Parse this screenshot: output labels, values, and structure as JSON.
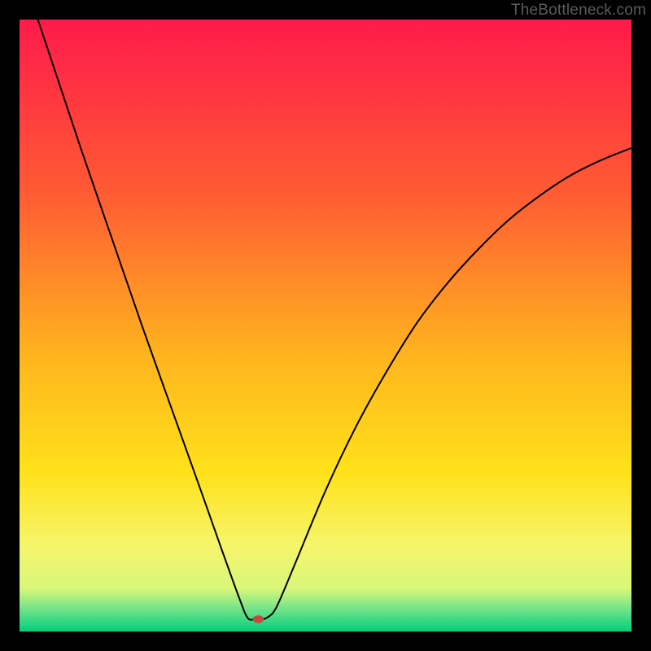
{
  "attribution": "TheBottleneck.com",
  "chart_data": {
    "type": "line",
    "title": "",
    "xlabel": "",
    "ylabel": "",
    "xlim": [
      0,
      100
    ],
    "ylim": [
      0,
      100
    ],
    "background_gradient": {
      "stops": [
        {
          "offset": 0.0,
          "color": "#ff1a4b"
        },
        {
          "offset": 0.28,
          "color": "#ff5a34"
        },
        {
          "offset": 0.55,
          "color": "#ffb41e"
        },
        {
          "offset": 0.74,
          "color": "#ffe11a"
        },
        {
          "offset": 0.86,
          "color": "#f6f56b"
        },
        {
          "offset": 0.93,
          "color": "#d8f77a"
        },
        {
          "offset": 0.965,
          "color": "#6ee28a"
        },
        {
          "offset": 1.0,
          "color": "#00d07a"
        }
      ]
    },
    "series": [
      {
        "name": "bottleneck-curve",
        "color": "#000000",
        "points": [
          {
            "x": 3.0,
            "y": 100.0
          },
          {
            "x": 6.0,
            "y": 91.0
          },
          {
            "x": 10.0,
            "y": 79.0
          },
          {
            "x": 15.0,
            "y": 64.5
          },
          {
            "x": 20.0,
            "y": 50.0
          },
          {
            "x": 25.0,
            "y": 36.0
          },
          {
            "x": 30.0,
            "y": 22.0
          },
          {
            "x": 33.0,
            "y": 13.5
          },
          {
            "x": 36.0,
            "y": 5.2
          },
          {
            "x": 37.3,
            "y": 2.2
          },
          {
            "x": 38.5,
            "y": 2.0
          },
          {
            "x": 39.5,
            "y": 2.0
          },
          {
            "x": 40.5,
            "y": 2.3
          },
          {
            "x": 42.0,
            "y": 4.0
          },
          {
            "x": 45.0,
            "y": 11.0
          },
          {
            "x": 50.0,
            "y": 23.0
          },
          {
            "x": 55.0,
            "y": 33.5
          },
          {
            "x": 60.0,
            "y": 42.5
          },
          {
            "x": 65.0,
            "y": 50.5
          },
          {
            "x": 70.0,
            "y": 57.0
          },
          {
            "x": 75.0,
            "y": 62.5
          },
          {
            "x": 80.0,
            "y": 67.3
          },
          {
            "x": 85.0,
            "y": 71.2
          },
          {
            "x": 90.0,
            "y": 74.5
          },
          {
            "x": 95.0,
            "y": 77.0
          },
          {
            "x": 100.0,
            "y": 79.0
          }
        ]
      }
    ],
    "marker": {
      "name": "optimum-marker",
      "x": 39.0,
      "y": 2.0,
      "rx": 0.9,
      "ry": 0.65,
      "color": "#c44a3f"
    }
  }
}
